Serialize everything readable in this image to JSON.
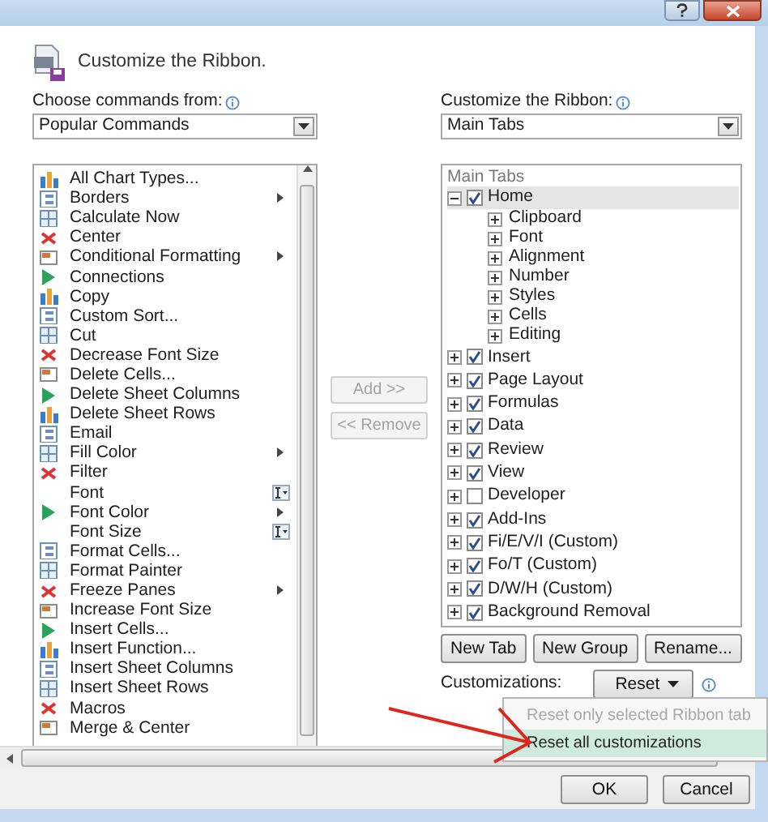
{
  "dialog": {
    "heading": "Customize the Ribbon."
  },
  "left": {
    "label": "Choose commands from:",
    "select_value": "Popular Commands",
    "commands": [
      {
        "label": "All Chart Types...",
        "kind": "command"
      },
      {
        "label": "Borders",
        "kind": "submenu"
      },
      {
        "label": "Calculate Now",
        "kind": "command"
      },
      {
        "label": "Center",
        "kind": "command"
      },
      {
        "label": "Conditional Formatting",
        "kind": "submenu"
      },
      {
        "label": "Connections",
        "kind": "command"
      },
      {
        "label": "Copy",
        "kind": "command"
      },
      {
        "label": "Custom Sort...",
        "kind": "command"
      },
      {
        "label": "Cut",
        "kind": "command"
      },
      {
        "label": "Decrease Font Size",
        "kind": "command"
      },
      {
        "label": "Delete Cells...",
        "kind": "command"
      },
      {
        "label": "Delete Sheet Columns",
        "kind": "command"
      },
      {
        "label": "Delete Sheet Rows",
        "kind": "command"
      },
      {
        "label": "Email",
        "kind": "command"
      },
      {
        "label": "Fill Color",
        "kind": "submenu"
      },
      {
        "label": "Filter",
        "kind": "command"
      },
      {
        "label": "Font",
        "kind": "combo"
      },
      {
        "label": "Font Color",
        "kind": "submenu"
      },
      {
        "label": "Font Size",
        "kind": "combo"
      },
      {
        "label": "Format Cells...",
        "kind": "command"
      },
      {
        "label": "Format Painter",
        "kind": "command"
      },
      {
        "label": "Freeze Panes",
        "kind": "submenu"
      },
      {
        "label": "Increase Font Size",
        "kind": "command"
      },
      {
        "label": "Insert Cells...",
        "kind": "command"
      },
      {
        "label": "Insert Function...",
        "kind": "command"
      },
      {
        "label": "Insert Sheet Columns",
        "kind": "command"
      },
      {
        "label": "Insert Sheet Rows",
        "kind": "command"
      },
      {
        "label": "Macros",
        "kind": "command"
      },
      {
        "label": "Merge & Center",
        "kind": "command"
      }
    ]
  },
  "middle": {
    "buttons": [
      {
        "label": "Add >>",
        "disabled": true
      },
      {
        "label": "<< Remove",
        "disabled": true
      }
    ]
  },
  "right": {
    "label": "Customize the Ribbon:",
    "select_value": "Main Tabs",
    "tree_header": "Main Tabs",
    "tabs": [
      {
        "label": "Home",
        "checked": true,
        "expanded": true,
        "selected": true,
        "children": [
          {
            "label": "Clipboard",
            "expanded": false
          },
          {
            "label": "Font",
            "expanded": false
          },
          {
            "label": "Alignment",
            "expanded": false
          },
          {
            "label": "Number",
            "expanded": false
          },
          {
            "label": "Styles",
            "expanded": false
          },
          {
            "label": "Cells",
            "expanded": false
          },
          {
            "label": "Editing",
            "expanded": false
          }
        ]
      },
      {
        "label": "Insert",
        "checked": true,
        "expanded": false,
        "selected": false
      },
      {
        "label": "Page Layout",
        "checked": true,
        "expanded": false,
        "selected": false
      },
      {
        "label": "Formulas",
        "checked": true,
        "expanded": false,
        "selected": false
      },
      {
        "label": "Data",
        "checked": true,
        "expanded": false,
        "selected": false
      },
      {
        "label": "Review",
        "checked": true,
        "expanded": false,
        "selected": false
      },
      {
        "label": "View",
        "checked": true,
        "expanded": false,
        "selected": false
      },
      {
        "label": "Developer",
        "checked": false,
        "expanded": false,
        "selected": false
      },
      {
        "label": "Add-Ins",
        "checked": true,
        "expanded": false,
        "selected": false
      },
      {
        "label": "Fi/E/V/I (Custom)",
        "checked": true,
        "expanded": false,
        "selected": false
      },
      {
        "label": "Fo/T (Custom)",
        "checked": true,
        "expanded": false,
        "selected": false
      },
      {
        "label": "D/W/H (Custom)",
        "checked": true,
        "expanded": false,
        "selected": false
      },
      {
        "label": "Background Removal",
        "checked": true,
        "expanded": false,
        "selected": false
      }
    ],
    "buttons": [
      "New Tab",
      "New Group",
      "Rename..."
    ],
    "customizations_label": "Customizations:",
    "reset_button": "Reset"
  },
  "reset_menu": [
    {
      "label": "Reset only selected Ribbon tab",
      "disabled": true,
      "selected": false
    },
    {
      "label": "Reset all customizations",
      "disabled": false,
      "selected": true
    }
  ],
  "footer_buttons": [
    "OK",
    "Cancel"
  ]
}
